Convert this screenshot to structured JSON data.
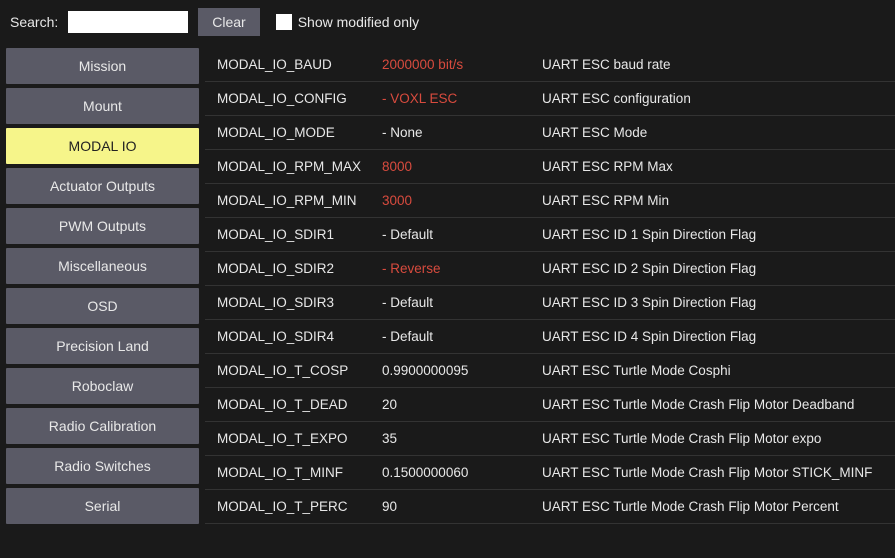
{
  "topbar": {
    "search_label": "Search:",
    "search_value": "",
    "clear_label": "Clear",
    "modified_label": "Show modified only",
    "modified_checked": false
  },
  "sidebar": {
    "items": [
      {
        "label": "Mission",
        "active": false
      },
      {
        "label": "Mount",
        "active": false
      },
      {
        "label": "MODAL IO",
        "active": true
      },
      {
        "label": "Actuator Outputs",
        "active": false
      },
      {
        "label": "PWM Outputs",
        "active": false
      },
      {
        "label": "Miscellaneous",
        "active": false
      },
      {
        "label": "OSD",
        "active": false
      },
      {
        "label": "Precision Land",
        "active": false
      },
      {
        "label": "Roboclaw",
        "active": false
      },
      {
        "label": "Radio Calibration",
        "active": false
      },
      {
        "label": "Radio Switches",
        "active": false
      },
      {
        "label": "Serial",
        "active": false
      }
    ]
  },
  "params": [
    {
      "name": "MODAL_IO_BAUD",
      "value": "2000000 bit/s",
      "modified": true,
      "desc": "UART ESC baud rate"
    },
    {
      "name": "MODAL_IO_CONFIG",
      "value": "- VOXL ESC",
      "modified": true,
      "desc": "UART ESC configuration"
    },
    {
      "name": "MODAL_IO_MODE",
      "value": "- None",
      "modified": false,
      "desc": "UART ESC Mode"
    },
    {
      "name": "MODAL_IO_RPM_MAX",
      "value": "8000",
      "modified": true,
      "desc": "UART ESC RPM Max"
    },
    {
      "name": "MODAL_IO_RPM_MIN",
      "value": "3000",
      "modified": true,
      "desc": "UART ESC RPM Min"
    },
    {
      "name": "MODAL_IO_SDIR1",
      "value": "- Default",
      "modified": false,
      "desc": "UART ESC ID 1 Spin Direction Flag"
    },
    {
      "name": "MODAL_IO_SDIR2",
      "value": "- Reverse",
      "modified": true,
      "desc": "UART ESC ID 2 Spin Direction Flag"
    },
    {
      "name": "MODAL_IO_SDIR3",
      "value": "- Default",
      "modified": false,
      "desc": "UART ESC ID 3 Spin Direction Flag"
    },
    {
      "name": "MODAL_IO_SDIR4",
      "value": "- Default",
      "modified": false,
      "desc": "UART ESC ID 4 Spin Direction Flag"
    },
    {
      "name": "MODAL_IO_T_COSP",
      "value": "0.9900000095",
      "modified": false,
      "desc": "UART ESC Turtle Mode Cosphi"
    },
    {
      "name": "MODAL_IO_T_DEAD",
      "value": "20",
      "modified": false,
      "desc": "UART ESC Turtle Mode Crash Flip Motor Deadband"
    },
    {
      "name": "MODAL_IO_T_EXPO",
      "value": "35",
      "modified": false,
      "desc": "UART ESC Turtle Mode Crash Flip Motor expo"
    },
    {
      "name": "MODAL_IO_T_MINF",
      "value": "0.1500000060",
      "modified": false,
      "desc": "UART ESC Turtle Mode Crash Flip Motor STICK_MINF"
    },
    {
      "name": "MODAL_IO_T_PERC",
      "value": "90",
      "modified": false,
      "desc": "UART ESC Turtle Mode Crash Flip Motor Percent"
    }
  ]
}
